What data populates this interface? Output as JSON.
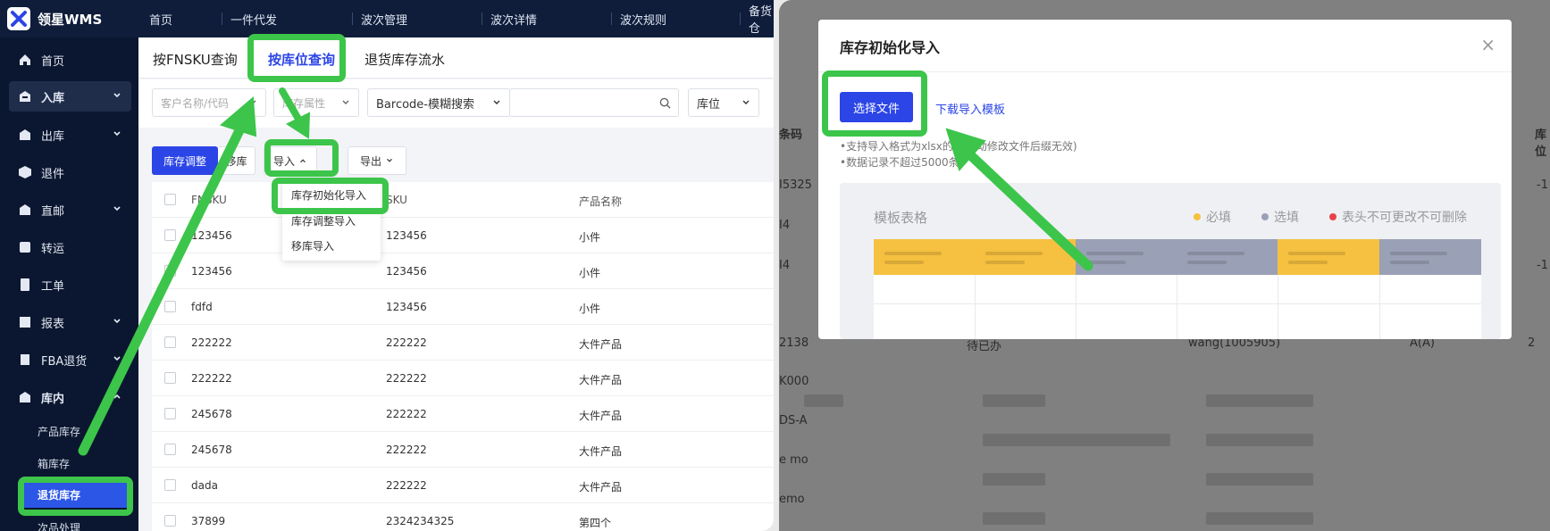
{
  "app": {
    "name": "领星WMS"
  },
  "top_nav": [
    "首页",
    "一件代发",
    "波次管理",
    "波次详情",
    "波次规则",
    "备货仓"
  ],
  "sidebar": {
    "items": [
      {
        "label": "首页"
      },
      {
        "label": "入库"
      },
      {
        "label": "出库"
      },
      {
        "label": "退件"
      },
      {
        "label": "直邮"
      },
      {
        "label": "转运"
      },
      {
        "label": "工单"
      },
      {
        "label": "报表"
      },
      {
        "label": "FBA退货"
      },
      {
        "label": "库内"
      }
    ],
    "sub_items": [
      "产品库存",
      "箱库存",
      "退货库存",
      "次品处理"
    ]
  },
  "tabs": [
    "按FNSKU查询",
    "按库位查询",
    "退货库存流水"
  ],
  "filters": {
    "customer_placeholder": "客户名称/代码",
    "attr_placeholder": "库存属性",
    "barcode_mode": "Barcode-模糊搜索",
    "location": "库位"
  },
  "toolbar": {
    "adjust": "库存调整",
    "move": "移库",
    "import": "导入",
    "export": "导出"
  },
  "import_menu": [
    "库存初始化导入",
    "库存调整导入",
    "移库导入"
  ],
  "table": {
    "headers": [
      "FNSKU",
      "SKU",
      "产品名称"
    ],
    "rows": [
      {
        "fnsku": "123456",
        "sku": "123456",
        "name": "小件"
      },
      {
        "fnsku": "123456",
        "sku": "123456",
        "name": "小件"
      },
      {
        "fnsku": "fdfd",
        "sku": "123456",
        "name": "小件"
      },
      {
        "fnsku": "222222",
        "sku": "222222",
        "name": "大件产品"
      },
      {
        "fnsku": "222222",
        "sku": "222222",
        "name": "大件产品"
      },
      {
        "fnsku": "245678",
        "sku": "222222",
        "name": "大件产品"
      },
      {
        "fnsku": "245678",
        "sku": "222222",
        "name": "大件产品"
      },
      {
        "fnsku": "dada",
        "sku": "222222",
        "name": "大件产品"
      },
      {
        "fnsku": "37899",
        "sku": "2324234325",
        "name": "第四个"
      }
    ]
  },
  "background_fragments": {
    "col_code": "条码",
    "col_loc": "库位",
    "row_code_1": "I5325",
    "row_code_2": "I4",
    "row_code_3": "I4",
    "row_code_4": "2138",
    "row_code_5": "K000",
    "row_code_6": "DS-A",
    "row_code_7": "e mo",
    "row_code_8": "emo",
    "status": "待已办",
    "user": "wang(1005905)",
    "loc_value": "A(A)",
    "count": "2",
    "side_1": "-1",
    "side_2": "-1"
  },
  "modal": {
    "title": "库存初始化导入",
    "close": "×",
    "choose_file": "选择文件",
    "download_template": "下载导入模板",
    "notes": [
      "•支持导入格式为xlsx的",
      "•数据记录不超过5000条"
    ],
    "notes_tail": "动修改文件后缀无效)",
    "template_title": "模板表格",
    "legend": [
      {
        "label": "必填",
        "color": "#f6c040"
      },
      {
        "label": "选填",
        "color": "#9aa0b5"
      },
      {
        "label": "表头不可更改不可删除",
        "color": "#e8434a"
      }
    ]
  },
  "colors": {
    "accent": "#2b45e6",
    "sidebar": "#0b1730",
    "highlight": "#3cc54a"
  }
}
